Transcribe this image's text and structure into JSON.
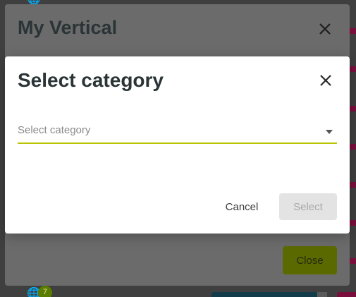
{
  "outer_dialog": {
    "title": "My Vertical",
    "close_button_label": "Close"
  },
  "dialog": {
    "title": "Select category",
    "select": {
      "placeholder": "Select category",
      "value": ""
    },
    "cancel_label": "Cancel",
    "select_label": "Select"
  },
  "background": {
    "badge_count": "7"
  },
  "colors": {
    "accent_underline": "#b8c400",
    "primary_button": "#5b6a00",
    "brand_magenta": "#7a0f3d"
  },
  "icons": {
    "close": "close-icon",
    "dropdown": "chevron-down-icon",
    "globe": "globe-icon"
  }
}
